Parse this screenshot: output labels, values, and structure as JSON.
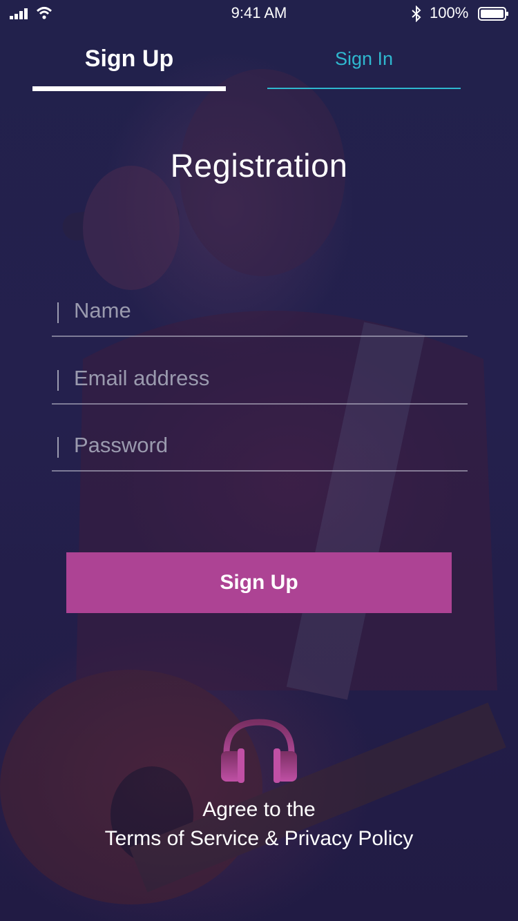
{
  "status_bar": {
    "time": "9:41 AM",
    "battery": "100%"
  },
  "tabs": {
    "signup_label": "Sign Up",
    "signin_label": "Sign In",
    "active": "signup"
  },
  "title": "Registration",
  "form": {
    "name_placeholder": "Name",
    "email_placeholder": "Email address",
    "password_placeholder": "Password"
  },
  "signup_button": "Sign Up",
  "terms": {
    "line1": "Agree to the",
    "line2": "Terms of Service & Privacy Policy"
  },
  "colors": {
    "background": "#1d1b45",
    "accent_button": "#ad4394",
    "signin_accent": "#2fb8cf",
    "logo_gradient_top": "#7a2f63",
    "logo_gradient_bottom": "#c050a5"
  },
  "icons": [
    "signal-icon",
    "wifi-icon",
    "bluetooth-icon",
    "battery-icon",
    "headphones-logo-icon"
  ]
}
